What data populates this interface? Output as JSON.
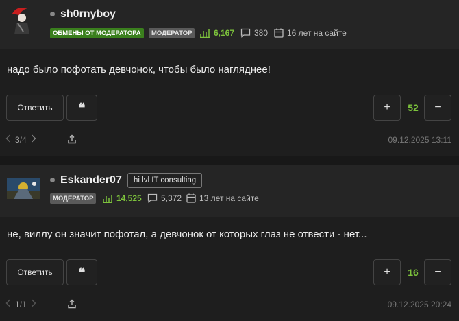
{
  "posts": [
    {
      "username": "sh0rnyboy",
      "badges": [
        "ОБМЕНЫ ОТ МОДЕРАТОРА",
        "МОДЕРАТОР"
      ],
      "reputation": "6,167",
      "messages": "380",
      "membership": "16 лет на сайте",
      "text": "надо было пофотать девчонок, чтобы было нагляднее!",
      "reply_label": "Ответить",
      "quote_label": "❝",
      "vote_plus": "+",
      "vote_minus": "−",
      "votes": "52",
      "page_current": "3",
      "page_sep": "/",
      "page_total": "4",
      "date": "09.12.2025 13:11"
    },
    {
      "username": "Eskander07",
      "custom_title": "hi lvl IT consulting",
      "badges": [
        "МОДЕРАТОР"
      ],
      "reputation": "14,525",
      "messages": "5,372",
      "membership": "13 лет на сайте",
      "text": "не, виллу он значит пофотал, а девчонок от которых глаз не отвести - нет...",
      "reply_label": "Ответить",
      "quote_label": "❝",
      "vote_plus": "+",
      "vote_minus": "−",
      "votes": "16",
      "page_current": "1",
      "page_sep": "/",
      "page_total": "1",
      "date": "09.12.2025 20:24"
    }
  ],
  "icons": {
    "reputation": "bar-chart-icon",
    "messages": "chat-bubble-icon",
    "membership": "calendar-icon",
    "share": "share-icon",
    "prev": "chevron-left-icon",
    "next": "chevron-right-icon"
  },
  "colors": {
    "accent_green": "#7cc23c",
    "badge_green": "#3a7f1d",
    "badge_gray": "#5a5a5a",
    "background": "#1e1e1e",
    "header_bg": "#252525"
  }
}
